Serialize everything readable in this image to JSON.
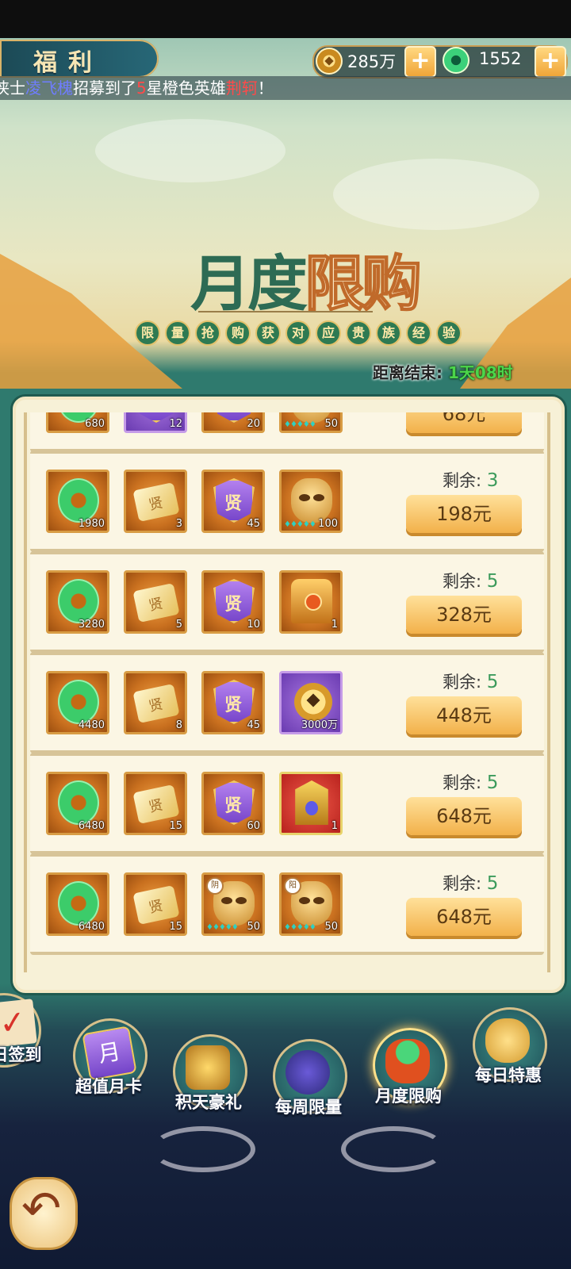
{
  "header": {
    "title": "福利",
    "coins": "285万",
    "jade": "1552",
    "marquee": {
      "prefix": "侠士",
      "player": "凌飞槐",
      "mid1": "招募到了",
      "stars": "5",
      "mid2": "星橙色英雄",
      "hero": "荆轲",
      "end": "！"
    }
  },
  "banner": {
    "title_a": "月度",
    "title_b": "限购",
    "subtitle_chars": [
      "限",
      "量",
      "抢",
      "购",
      "获",
      "对",
      "应",
      "贵",
      "族",
      "经",
      "验"
    ],
    "countdown_label": "距离结束:",
    "countdown_value": "1天08时"
  },
  "offers": [
    {
      "remain_label": "剩余:",
      "remain": "",
      "price": "68元",
      "items": [
        {
          "icon": "jade-ring-icon",
          "qty": "680"
        },
        {
          "icon": "purple-item-icon",
          "qty": "12"
        },
        {
          "icon": "token-icon",
          "qty": "20"
        },
        {
          "icon": "mask-icon",
          "qty": "50"
        }
      ]
    },
    {
      "remain_label": "剩余:",
      "remain": "3",
      "price": "198元",
      "items": [
        {
          "icon": "jade-ring-icon",
          "qty": "1980"
        },
        {
          "icon": "scroll-icon",
          "qty": "3"
        },
        {
          "icon": "token-icon",
          "qty": "45"
        },
        {
          "icon": "mask-icon",
          "qty": "100"
        }
      ]
    },
    {
      "remain_label": "剩余:",
      "remain": "5",
      "price": "328元",
      "items": [
        {
          "icon": "jade-ring-icon",
          "qty": "3280"
        },
        {
          "icon": "scroll-icon",
          "qty": "5"
        },
        {
          "icon": "token-icon",
          "qty": "10"
        },
        {
          "icon": "chest-icon",
          "qty": "1"
        }
      ]
    },
    {
      "remain_label": "剩余:",
      "remain": "5",
      "price": "448元",
      "items": [
        {
          "icon": "jade-ring-icon",
          "qty": "4480"
        },
        {
          "icon": "scroll-icon",
          "qty": "8"
        },
        {
          "icon": "token-icon",
          "qty": "45"
        },
        {
          "icon": "coin-icon",
          "qty": "3000万"
        }
      ]
    },
    {
      "remain_label": "剩余:",
      "remain": "5",
      "price": "648元",
      "items": [
        {
          "icon": "jade-ring-icon",
          "qty": "6480"
        },
        {
          "icon": "scroll-icon",
          "qty": "15"
        },
        {
          "icon": "token-icon",
          "qty": "60"
        },
        {
          "icon": "shrine-icon",
          "qty": "1"
        }
      ]
    },
    {
      "remain_label": "剩余:",
      "remain": "5",
      "price": "648元",
      "items": [
        {
          "icon": "jade-ring-icon",
          "qty": "6480"
        },
        {
          "icon": "scroll-icon",
          "qty": "15"
        },
        {
          "icon": "mask-icon",
          "qty": "50",
          "badge": "阴"
        },
        {
          "icon": "mask-icon",
          "qty": "50",
          "badge": "阳"
        }
      ]
    }
  ],
  "nav": {
    "daily_sign": "日签到",
    "monthly_card": "超值月卡",
    "monthly_card_glyph": "月",
    "accumulate_gift": "积天豪礼",
    "weekly_limit": "每周限量",
    "monthly_limit": "月度限购",
    "daily_deal": "每日特惠"
  },
  "colors": {
    "accent": "#f2b14a",
    "remain": "#3d9b5c",
    "panel": "#f7f1d7",
    "teal": "#2f7a6e"
  }
}
